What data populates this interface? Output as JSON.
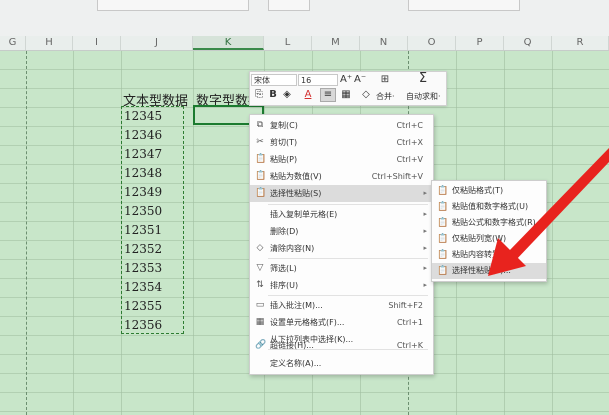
{
  "columns": [
    {
      "id": "G"
    },
    {
      "id": "H"
    },
    {
      "id": "I"
    },
    {
      "id": "J"
    },
    {
      "id": "K"
    },
    {
      "id": "L"
    },
    {
      "id": "M"
    },
    {
      "id": "N"
    },
    {
      "id": "O"
    },
    {
      "id": "P"
    },
    {
      "id": "Q"
    },
    {
      "id": "R"
    }
  ],
  "sheet": {
    "header_j": "文本型数据",
    "header_k": "数字型数据",
    "values": [
      "12345",
      "12346",
      "12347",
      "12348",
      "12349",
      "12350",
      "12351",
      "12352",
      "12353",
      "12354",
      "12355",
      "12356"
    ]
  },
  "mini_toolbar": {
    "font_name": "宋体",
    "font_size": "16",
    "grow_icon": "A⁺",
    "shrink_icon": "A⁻",
    "merge_label": "合并·",
    "autosum_label": "自动求和·"
  },
  "context_menu": {
    "items": [
      {
        "icon": "copy-icon",
        "glyph": "⧉",
        "label": "复制(C)",
        "shortcut": "Ctrl+C"
      },
      {
        "icon": "cut-icon",
        "glyph": "✂",
        "label": "剪切(T)",
        "shortcut": "Ctrl+X"
      },
      {
        "icon": "paste-icon",
        "glyph": "📋",
        "label": "粘贴(P)",
        "shortcut": "Ctrl+V"
      },
      {
        "icon": "paste-values-icon",
        "glyph": "📋",
        "label": "粘贴为数值(V)",
        "shortcut": "Ctrl+Shift+V"
      },
      {
        "icon": "paste-special-icon",
        "glyph": "📋",
        "label": "选择性粘贴(S)",
        "shortcut": ""
      },
      {
        "icon": "",
        "glyph": "",
        "label": "插入复制单元格(E)",
        "shortcut": ""
      },
      {
        "icon": "",
        "glyph": "",
        "label": "删除(D)",
        "shortcut": ""
      },
      {
        "icon": "clear-icon",
        "glyph": "◇",
        "label": "清除内容(N)",
        "shortcut": ""
      },
      {
        "icon": "filter-icon",
        "glyph": "▽",
        "label": "筛选(L)",
        "shortcut": ""
      },
      {
        "icon": "sort-icon",
        "glyph": "⇅",
        "label": "排序(U)",
        "shortcut": ""
      },
      {
        "icon": "comment-icon",
        "glyph": "▭",
        "label": "插入批注(M)...",
        "shortcut": "Shift+F2"
      },
      {
        "icon": "format-cells-icon",
        "glyph": "▦",
        "label": "设置单元格格式(F)...",
        "shortcut": "Ctrl+1"
      },
      {
        "icon": "",
        "glyph": "",
        "label": "从下拉列表中选择(K)...",
        "shortcut": ""
      },
      {
        "icon": "hyperlink-icon",
        "glyph": "🔗",
        "label": "超链接(H)...",
        "shortcut": "Ctrl+K"
      },
      {
        "icon": "",
        "glyph": "",
        "label": "定义名称(A)...",
        "shortcut": ""
      }
    ]
  },
  "submenu": {
    "items": [
      {
        "glyph": "📋",
        "label": "仅粘贴格式(T)"
      },
      {
        "glyph": "📋",
        "label": "粘贴值和数字格式(U)"
      },
      {
        "glyph": "📋",
        "label": "粘贴公式和数字格式(R)"
      },
      {
        "glyph": "📋",
        "label": "仅粘贴列宽(W)"
      },
      {
        "glyph": "📋",
        "label": "粘贴内容转置(E)"
      },
      {
        "glyph": "📋",
        "label": "选择性粘贴(S)..."
      }
    ]
  },
  "colors": {
    "sheet_bg": "#c8e6c9",
    "arrow": "#e8231e",
    "selection": "#1b7b2f"
  }
}
